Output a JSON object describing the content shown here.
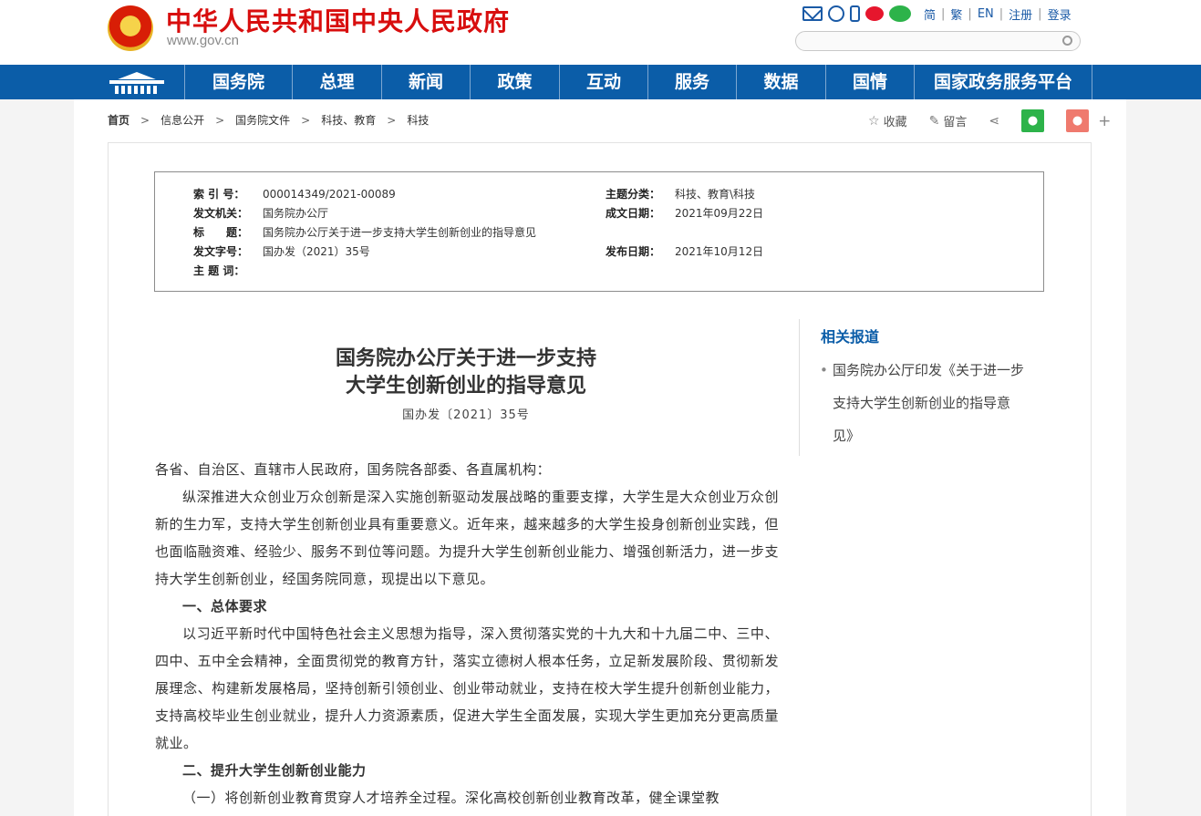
{
  "header": {
    "title": "中华人民共和国中央人民政府",
    "url": "www.gov.cn",
    "links": [
      "简",
      "繁",
      "EN",
      "注册",
      "登录"
    ],
    "search_placeholder": ""
  },
  "nav": {
    "items": [
      "国务院",
      "总理",
      "新闻",
      "政策",
      "互动",
      "服务",
      "数据",
      "国情",
      "国家政务服务平台"
    ]
  },
  "breadcrumb": [
    "首页",
    "信息公开",
    "国务院文件",
    "科技、教育",
    "科技"
  ],
  "share": {
    "favorite": "收藏",
    "comment": "留言"
  },
  "meta": {
    "index_no_k": "索 引 号：",
    "index_no_v": "000014349/2021-00089",
    "topic_k": "主题分类：",
    "topic_v": "科技、教育\\科技",
    "issuer_k": "发文机关：",
    "issuer_v": "国务院办公厅",
    "written_k": "成文日期：",
    "written_v": "2021年09月22日",
    "title_k": "标　　题：",
    "title_v": "国务院办公厅关于进一步支持大学生创新创业的指导意见",
    "docno_k": "发文字号：",
    "docno_v": "国办发（2021）35号",
    "pub_k": "发布日期：",
    "pub_v": "2021年10月12日",
    "keywords_k": "主 题 词：",
    "keywords_v": ""
  },
  "article": {
    "title_line1": "国务院办公厅关于进一步支持",
    "title_line2": "大学生创新创业的指导意见",
    "doc_no": "国办发〔2021〕35号",
    "salutation": "各省、自治区、直辖市人民政府，国务院各部委、各直属机构：",
    "p1": "纵深推进大众创业万众创新是深入实施创新驱动发展战略的重要支撑，大学生是大众创业万众创新的生力军，支持大学生创新创业具有重要意义。近年来，越来越多的大学生投身创新创业实践，但也面临融资难、经验少、服务不到位等问题。为提升大学生创新创业能力、增强创新活力，进一步支持大学生创新创业，经国务院同意，现提出以下意见。",
    "h1": "一、总体要求",
    "p2": "以习近平新时代中国特色社会主义思想为指导，深入贯彻落实党的十九大和十九届二中、三中、四中、五中全会精神，全面贯彻党的教育方针，落实立德树人根本任务，立足新发展阶段、贯彻新发展理念、构建新发展格局，坚持创新引领创业、创业带动就业，支持在校大学生提升创新创业能力，支持高校毕业生创业就业，提升人力资源素质，促进大学生全面发展，实现大学生更加充分更高质量就业。",
    "h2": "二、提升大学生创新创业能力",
    "p3_lead": "（一）将创新创业教育贯穿人才培养全过程。",
    "p3_rest": "深化高校创新创业教育改革，健全课堂教"
  },
  "related": {
    "title": "相关报道",
    "item": "国务院办公厅印发《关于进一步支持大学生创新创业的指导意见》"
  }
}
